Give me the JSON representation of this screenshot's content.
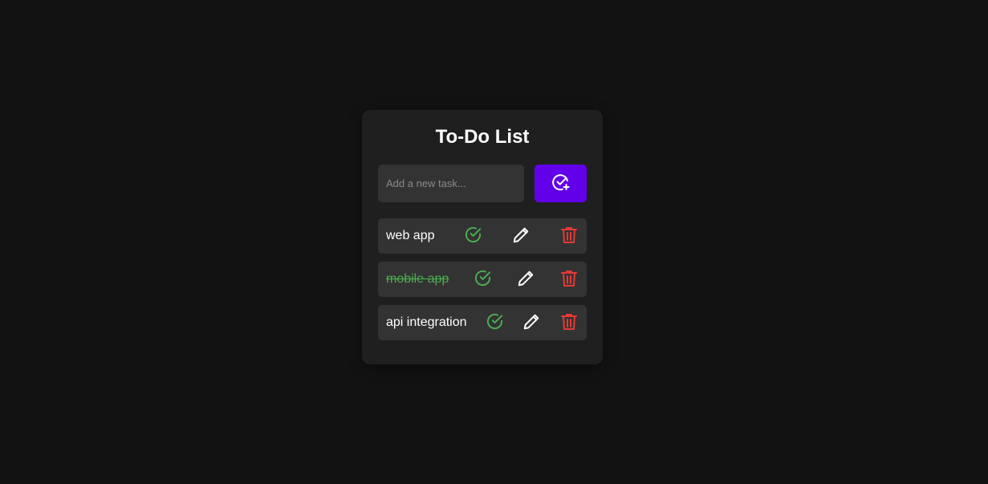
{
  "app": {
    "title": "To-Do List"
  },
  "input": {
    "placeholder": "Add a new task...",
    "value": ""
  },
  "add_button": {
    "icon": "check-circle-plus-icon",
    "color": "#6200ea"
  },
  "tasks": [
    {
      "text": "web app",
      "completed": false
    },
    {
      "text": "mobile app",
      "completed": true
    },
    {
      "text": "api integration",
      "completed": false
    }
  ],
  "task_actions": {
    "complete_icon": "check-circle-icon",
    "edit_icon": "pencil-icon",
    "delete_icon": "trash-icon"
  },
  "colors": {
    "background": "#121212",
    "card": "#1f1f1f",
    "row": "#333333",
    "accent": "#6200ea",
    "complete": "#4caf50",
    "delete": "#e53935",
    "text": "#ffffff"
  }
}
